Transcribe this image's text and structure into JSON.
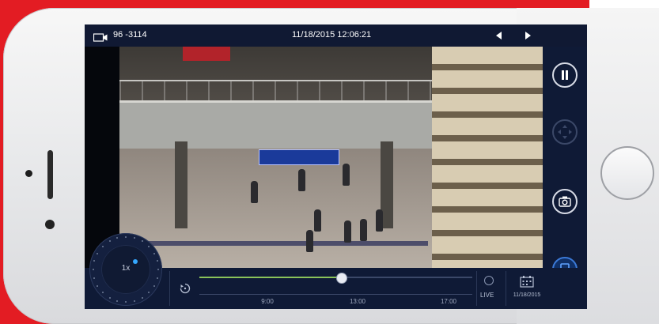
{
  "app": {
    "camera_name": "96 -3114",
    "timestamp": "11/18/2015  12:06:21",
    "zoom_level": "1x",
    "live_label": "LIVE",
    "date_button_label": "11/18/2015"
  },
  "timeline": {
    "tick_labels": [
      "9:00",
      "13:00",
      "17:00"
    ],
    "playback_position_fraction": 0.52
  },
  "icons": {
    "camera": "video-camera-icon",
    "prev": "triangle-left-icon",
    "next": "triangle-right-icon",
    "pause": "pause-icon",
    "ptz": "ptz-directional-icon",
    "snapshot": "camera-snapshot-icon",
    "record": "film-strip-icon",
    "replay": "replay-icon",
    "live": "live-clock-icon",
    "calendar": "calendar-icon"
  },
  "colors": {
    "accent_red": "#e31c23",
    "ui_dark": "#0f1a36",
    "progress_green": "#8ac35a",
    "record_blue": "#3b79d6"
  }
}
